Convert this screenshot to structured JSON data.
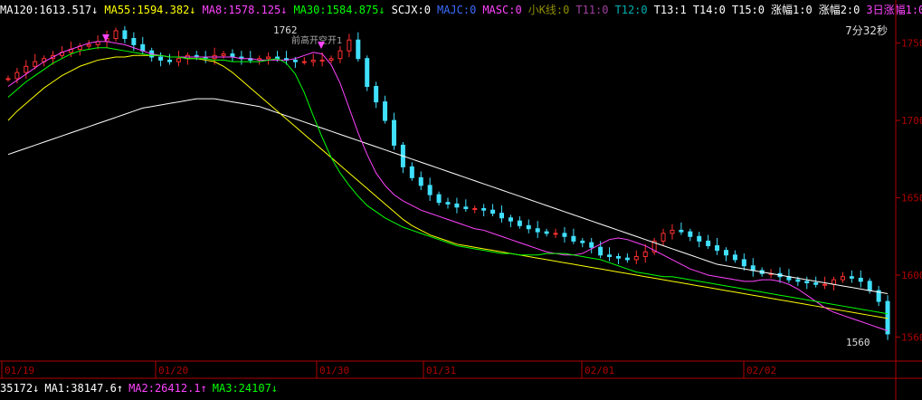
{
  "header": {
    "items": [
      {
        "text": "MA120:1613.517",
        "arrow": "↓",
        "color": "#ffffff"
      },
      {
        "text": "MA55:1594.382",
        "arrow": "↓",
        "color": "#ffff00"
      },
      {
        "text": "MA8:1578.125",
        "arrow": "↓",
        "color": "#ff44ff"
      },
      {
        "text": "MA30:1584.875",
        "arrow": "↓",
        "color": "#00ff00"
      },
      {
        "text": "SCJX:0",
        "arrow": "",
        "color": "#ffffff"
      },
      {
        "text": "MAJC:0",
        "arrow": "",
        "color": "#3c6cff"
      },
      {
        "text": "MASC:0",
        "arrow": "",
        "color": "#ff44ff"
      },
      {
        "text": "小K线:0",
        "arrow": "",
        "color": "#8e8e00"
      },
      {
        "text": "T11:0",
        "arrow": "",
        "color": "#a040a0"
      },
      {
        "text": "T12:0",
        "arrow": "",
        "color": "#00b0b0"
      },
      {
        "text": "T13:1",
        "arrow": "",
        "color": "#ffffff"
      },
      {
        "text": "T14:0",
        "arrow": "",
        "color": "#ffffff"
      },
      {
        "text": "T15:0",
        "arrow": "",
        "color": "#ffffff"
      },
      {
        "text": "涨幅1:0",
        "arrow": "",
        "color": "#ffffff"
      },
      {
        "text": "涨幅2:0",
        "arrow": "",
        "color": "#ffffff"
      },
      {
        "text": "3日涨幅1:0",
        "arrow": "",
        "color": "#ff44ff"
      }
    ]
  },
  "timer": "7分32秒",
  "peak_label": "1762",
  "peak_note": "前高开空开1",
  "low_label": "1560",
  "volume": {
    "items": [
      {
        "text": "35172",
        "arrow": "↓",
        "color": "#ffffff"
      },
      {
        "text": "MA1:38147.6",
        "arrow": "↑",
        "color": "#ffffff"
      },
      {
        "text": "MA2:26412.1",
        "arrow": "↑",
        "color": "#ff44ff"
      },
      {
        "text": "MA3:24107",
        "arrow": "↓",
        "color": "#00ff00"
      }
    ]
  },
  "colors": {
    "up": "#ff3030",
    "down": "#40e0ff",
    "axis": "#b00000",
    "ma120": "#ffffff",
    "ma55": "#ffff00",
    "ma8": "#ff44ff",
    "ma30": "#00ff00"
  },
  "chart_data": {
    "type": "line",
    "title": "",
    "x_labels": [
      "01/19",
      "01/20",
      "01/30",
      "01/31",
      "02/01",
      "02/02"
    ],
    "y_ticks": [
      1560,
      1600,
      1650,
      1700,
      1750
    ],
    "ylim": [
      1545,
      1765
    ],
    "price": [
      1727,
      1731,
      1735,
      1738,
      1740,
      1742,
      1744,
      1746,
      1748,
      1749,
      1751,
      1753,
      1758,
      1753,
      1749,
      1745,
      1741,
      1739,
      1738,
      1740,
      1742,
      1741,
      1740,
      1742,
      1743,
      1741,
      1740,
      1739,
      1740,
      1741,
      1740,
      1739,
      1738,
      1738,
      1739,
      1739,
      1740,
      1745,
      1752,
      1740,
      1722,
      1712,
      1700,
      1684,
      1670,
      1663,
      1658,
      1652,
      1647,
      1646,
      1644,
      1643,
      1643,
      1642,
      1640,
      1637,
      1635,
      1632,
      1630,
      1628,
      1627,
      1627,
      1625,
      1622,
      1621,
      1618,
      1613,
      1612,
      1611,
      1610,
      1612,
      1615,
      1622,
      1627,
      1629,
      1628,
      1625,
      1622,
      1619,
      1616,
      1613,
      1610,
      1606,
      1603,
      1601,
      1601,
      1599,
      1597,
      1596,
      1595,
      1594,
      1594,
      1597,
      1599,
      1598,
      1596,
      1590,
      1583,
      1562
    ],
    "series": [
      {
        "name": "MA120",
        "values": [
          1678,
          1680,
          1682,
          1684,
          1686,
          1688,
          1690,
          1692,
          1694,
          1696,
          1698,
          1700,
          1702,
          1704,
          1706,
          1708,
          1709,
          1710,
          1711,
          1712,
          1713,
          1714,
          1714,
          1714,
          1713,
          1712,
          1711,
          1710,
          1709,
          1707,
          1705,
          1703,
          1701,
          1699,
          1697,
          1695,
          1693,
          1691,
          1689,
          1687,
          1685,
          1683,
          1681,
          1679,
          1677,
          1675,
          1673,
          1671,
          1669,
          1667,
          1665,
          1663,
          1661,
          1659,
          1657,
          1655,
          1653,
          1651,
          1649,
          1647,
          1645,
          1643,
          1641,
          1639,
          1637,
          1635,
          1633,
          1631,
          1629,
          1627,
          1625,
          1623,
          1621,
          1619,
          1617,
          1615,
          1613,
          1611,
          1609,
          1607,
          1606,
          1605,
          1604,
          1603,
          1602,
          1601,
          1600,
          1599,
          1598,
          1597,
          1596,
          1595,
          1594,
          1593,
          1592,
          1591,
          1590,
          1589,
          1588
        ]
      },
      {
        "name": "MA55",
        "values": [
          1700,
          1706,
          1711,
          1716,
          1721,
          1725,
          1729,
          1732,
          1735,
          1737,
          1739,
          1740,
          1741,
          1741,
          1742,
          1742,
          1742,
          1742,
          1741,
          1741,
          1740,
          1740,
          1739,
          1738,
          1735,
          1731,
          1726,
          1721,
          1716,
          1711,
          1706,
          1701,
          1696,
          1691,
          1686,
          1681,
          1676,
          1671,
          1666,
          1661,
          1656,
          1651,
          1646,
          1641,
          1636,
          1632,
          1629,
          1626,
          1624,
          1622,
          1620,
          1619,
          1618,
          1617,
          1616,
          1615,
          1614,
          1613,
          1612,
          1611,
          1610,
          1609,
          1608,
          1607,
          1606,
          1605,
          1604,
          1603,
          1602,
          1601,
          1600,
          1599,
          1598,
          1597,
          1596,
          1595,
          1594,
          1593,
          1592,
          1591,
          1590,
          1589,
          1588,
          1587,
          1586,
          1585,
          1584,
          1583,
          1582,
          1581,
          1580,
          1579,
          1578,
          1577,
          1576,
          1575,
          1574,
          1573,
          1572
        ]
      },
      {
        "name": "MA8",
        "values": [
          1722,
          1726,
          1730,
          1734,
          1738,
          1741,
          1744,
          1746,
          1748,
          1750,
          1751,
          1751,
          1750,
          1749,
          1747,
          1745,
          1743,
          1742,
          1741,
          1741,
          1741,
          1741,
          1741,
          1741,
          1741,
          1741,
          1740,
          1740,
          1739,
          1739,
          1739,
          1739,
          1740,
          1742,
          1744,
          1743,
          1736,
          1724,
          1708,
          1692,
          1678,
          1666,
          1658,
          1652,
          1648,
          1645,
          1642,
          1640,
          1638,
          1636,
          1634,
          1632,
          1630,
          1629,
          1627,
          1625,
          1623,
          1621,
          1619,
          1617,
          1615,
          1614,
          1613,
          1613,
          1614,
          1617,
          1620,
          1623,
          1624,
          1623,
          1621,
          1619,
          1616,
          1613,
          1610,
          1607,
          1604,
          1602,
          1600,
          1599,
          1598,
          1597,
          1596,
          1596,
          1597,
          1597,
          1596,
          1594,
          1591,
          1587,
          1583,
          1579,
          1576,
          1574,
          1572,
          1570,
          1568,
          1566,
          1564
        ]
      },
      {
        "name": "MA30",
        "values": [
          1715,
          1720,
          1725,
          1729,
          1733,
          1737,
          1740,
          1743,
          1745,
          1746,
          1747,
          1747,
          1746,
          1745,
          1744,
          1743,
          1742,
          1742,
          1741,
          1741,
          1740,
          1740,
          1740,
          1739,
          1739,
          1738,
          1738,
          1738,
          1738,
          1739,
          1740,
          1737,
          1730,
          1718,
          1703,
          1689,
          1676,
          1666,
          1658,
          1651,
          1645,
          1641,
          1637,
          1634,
          1631,
          1629,
          1627,
          1625,
          1623,
          1621,
          1619,
          1618,
          1617,
          1616,
          1615,
          1614,
          1614,
          1613,
          1613,
          1613,
          1614,
          1614,
          1614,
          1613,
          1612,
          1611,
          1610,
          1608,
          1606,
          1604,
          1602,
          1601,
          1600,
          1599,
          1599,
          1598,
          1597,
          1596,
          1595,
          1594,
          1593,
          1592,
          1591,
          1590,
          1589,
          1588,
          1587,
          1586,
          1585,
          1584,
          1583,
          1582,
          1581,
          1580,
          1579,
          1578,
          1577,
          1576,
          1575
        ]
      }
    ]
  }
}
